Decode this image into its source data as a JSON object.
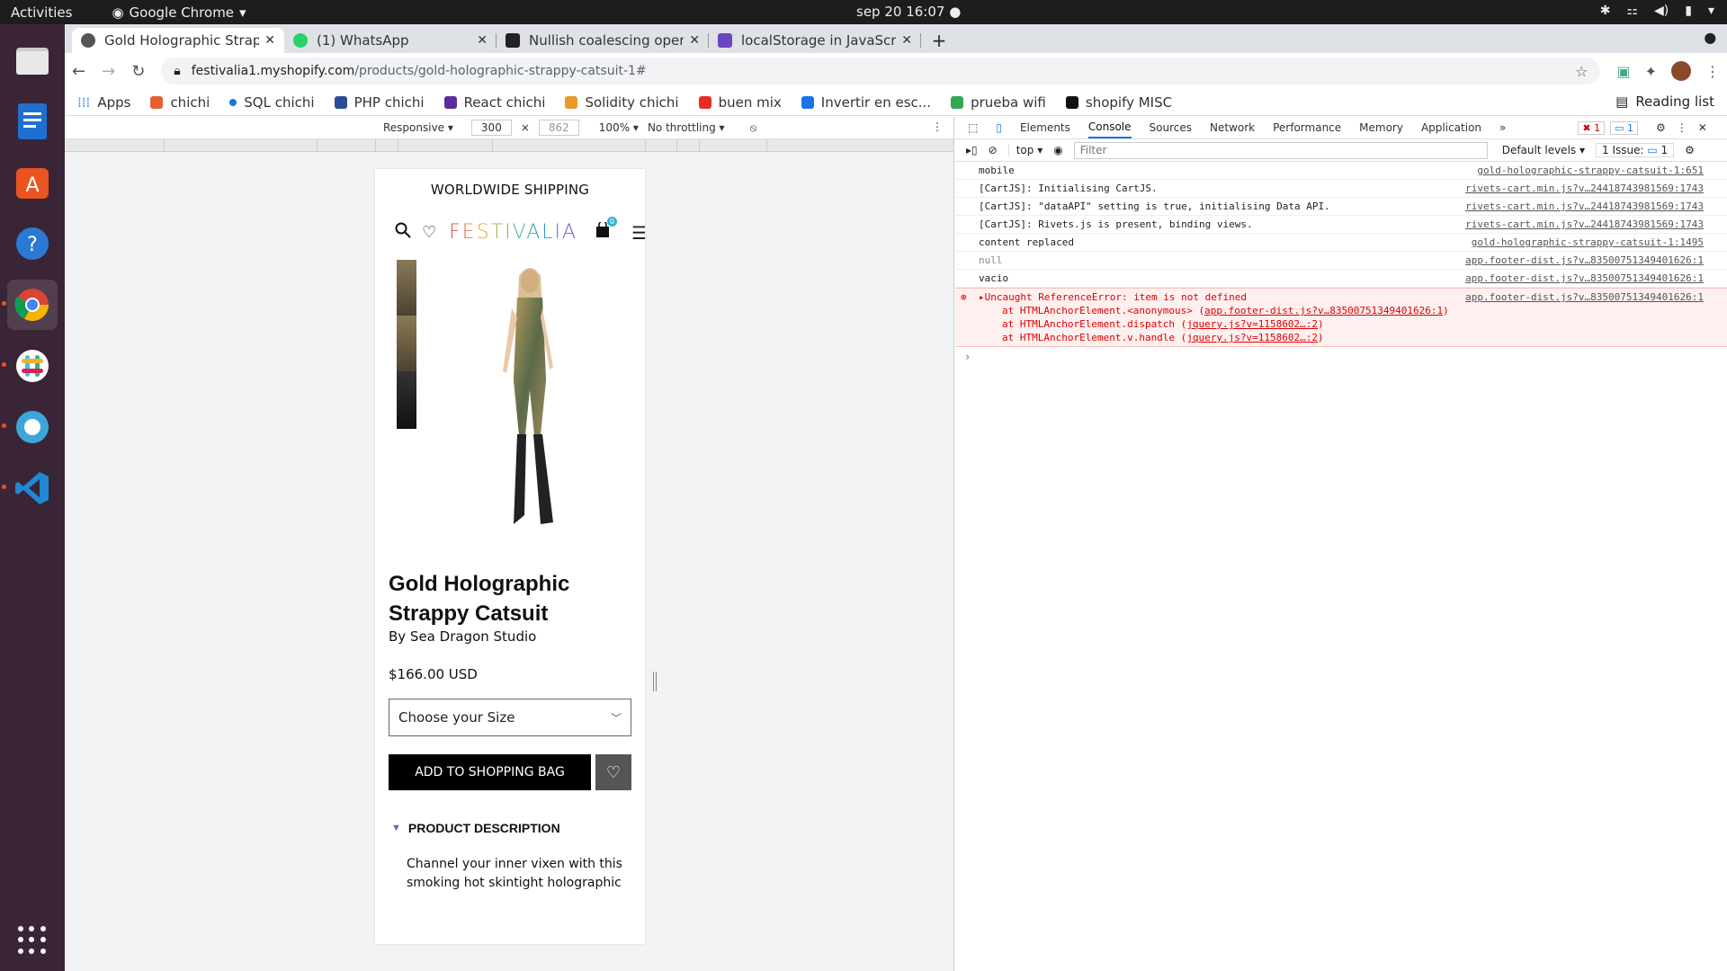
{
  "os": {
    "activities": "Activities",
    "app_name": "Google Chrome",
    "clock": "sep 20  16:07"
  },
  "tabs": [
    {
      "title": "Gold Holographic Strappy",
      "favcolor": "#555555"
    },
    {
      "title": "(1) WhatsApp",
      "favcolor": "#25d366"
    },
    {
      "title": "Nullish coalescing operat",
      "favcolor": "#222222"
    },
    {
      "title": "localStorage in JavaScrip",
      "favcolor": "#6b46c1"
    }
  ],
  "address": {
    "host": "festivalia1.myshopify.com",
    "path": "/products/gold-holographic-strappy-catsuit-1#"
  },
  "bookmarks": [
    {
      "label": "Apps",
      "color": "#4285f4"
    },
    {
      "label": "chichi",
      "color": "#e2622f"
    },
    {
      "label": "SQL chichi",
      "color": "#1a73e8"
    },
    {
      "label": "PHP chichi",
      "color": "#2a4d9b"
    },
    {
      "label": "React chichi",
      "color": "#5a2ca0"
    },
    {
      "label": "Solidity chichi",
      "color": "#e89a2a"
    },
    {
      "label": "buen mix",
      "color": "#e52d27"
    },
    {
      "label": "Invertir en esc...",
      "color": "#1a73e8"
    },
    {
      "label": "prueba wifi",
      "color": "#34a853"
    },
    {
      "label": "shopify MISC",
      "color": "#111111"
    }
  ],
  "reading_list": "Reading list",
  "device_toolbar": {
    "mode": "Responsive",
    "width": "300",
    "height": "862",
    "zoom": "100%",
    "throttle": "No throttling"
  },
  "shop": {
    "banner": "WORLDWIDE SHIPPING",
    "logo": "FESTIVALIA",
    "cart_count": "0",
    "product_name": "Gold Holographic Strappy Catsuit",
    "brand": "By Sea Dragon Studio",
    "price": "$166.00 USD",
    "size_placeholder": "Choose your Size",
    "add_button": "ADD TO SHOPPING BAG",
    "desc_heading": "PRODUCT DESCRIPTION",
    "desc_text": "Channel your inner vixen with this smoking hot skintight holographic"
  },
  "devtools": {
    "tabs": [
      "Elements",
      "Console",
      "Sources",
      "Network",
      "Performance",
      "Memory",
      "Application"
    ],
    "active_tab": "Console",
    "error_count": "1",
    "info_count": "1",
    "context": "top",
    "filter_placeholder": "Filter",
    "levels": "Default levels",
    "issues": "1 Issue:",
    "issues_count": "1"
  },
  "console": {
    "logs": [
      {
        "msg": "mobile",
        "src": "gold-holographic-strappy-catsuit-1:651"
      },
      {
        "msg": "[CartJS]: Initialising CartJS.",
        "src": "rivets-cart.min.js?v…244187439815​69:1743"
      },
      {
        "msg": "[CartJS]: \"dataAPI\" setting is true, initialising Data API.",
        "src": "rivets-cart.min.js?v…24418743981569:1743"
      },
      {
        "msg": "[CartJS]: Rivets.js is present, binding views.",
        "src": "rivets-cart.min.js?v…24418743981569:1743"
      },
      {
        "msg": "content replaced",
        "src": "gold-holographic-strappy-catsuit-1:1495"
      },
      {
        "msg": "null",
        "src": "app.footer-dist.js?v…835007513494016​26:1"
      },
      {
        "msg": "vacio",
        "src": "app.footer-dist.js?v…83500751349401626:1"
      }
    ],
    "error": {
      "msg": "Uncaught ReferenceError: item is not defined",
      "src": "app.footer-dist.js?v…83500751349401626:1",
      "stack": [
        {
          "pre": "at HTMLAnchorElement.<anonymous> (",
          "link": "app.footer-dist.js?v…835007513494016​26:1",
          "post": ")"
        },
        {
          "pre": "at HTMLAnchorElement.dispatch (",
          "link": "jquery.js?v=1158602…:2",
          "post": ")"
        },
        {
          "pre": "at HTMLAnchorElement.v.handle (",
          "link": "jquery.js?v=1158602…:2",
          "post": ")"
        }
      ]
    }
  }
}
